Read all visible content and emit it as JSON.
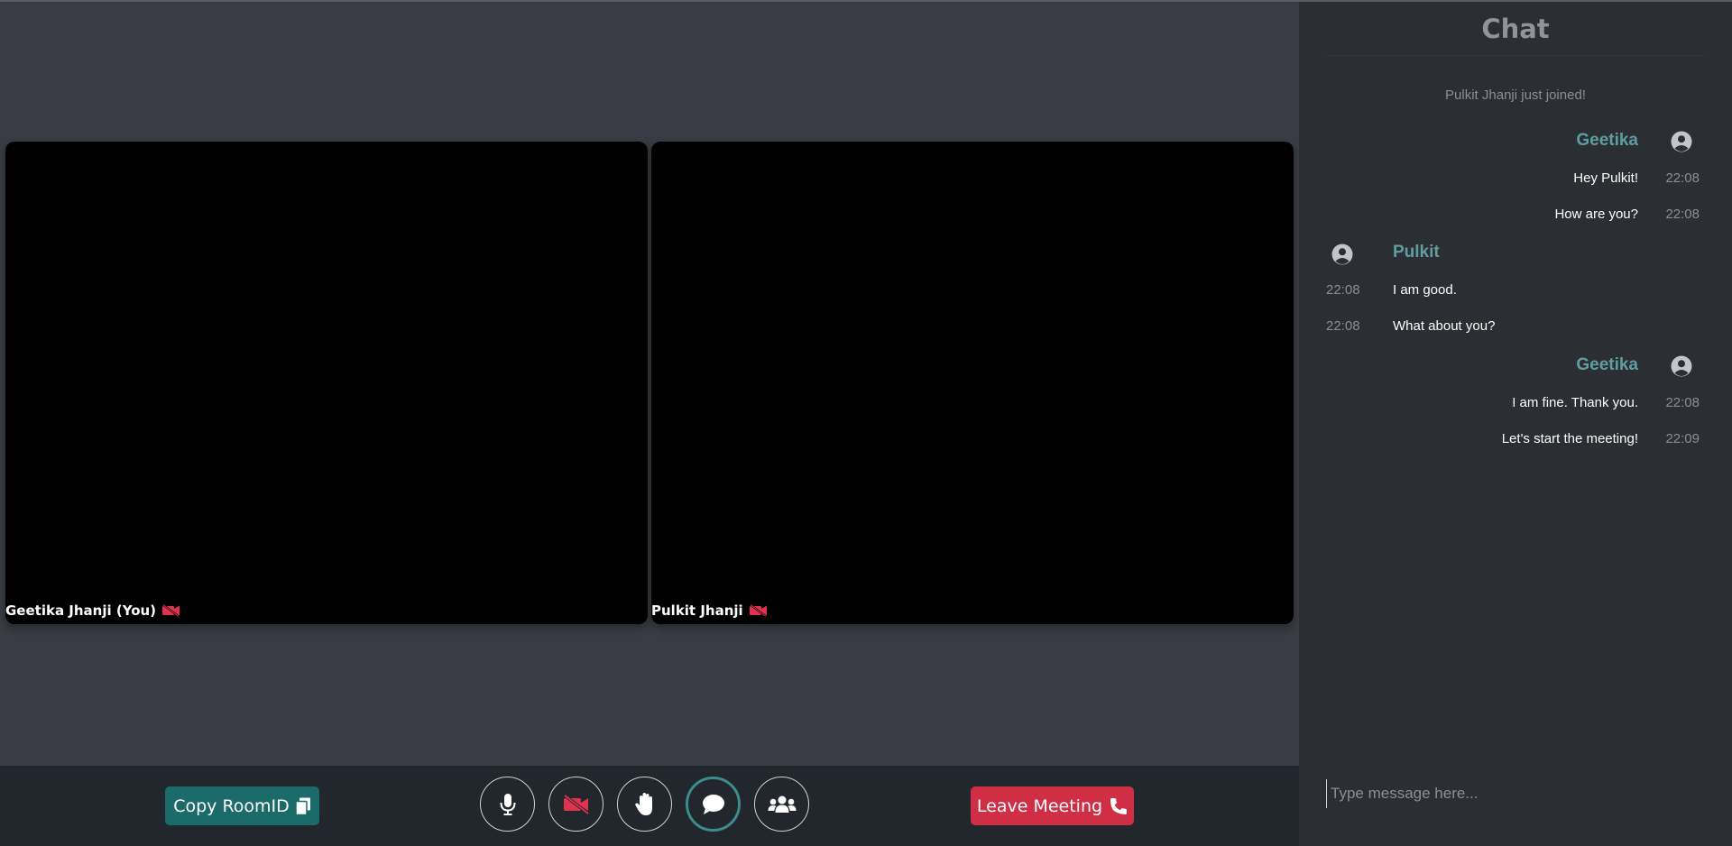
{
  "colors": {
    "stage_bg": "#393c44",
    "bar_bg": "#22262d",
    "chat_bg": "#2b2e33",
    "accent_teal": "#1b6b6a",
    "sender_teal": "#5e9ea0",
    "leave_red": "#cf2e45",
    "cam_off_red": "#e0334f"
  },
  "participants": [
    {
      "name": "Geetika Jhanji (You)",
      "status_icon": "video-off-icon"
    },
    {
      "name": "Pulkit Jhanji",
      "status_icon": "video-off-icon"
    }
  ],
  "toolbar": {
    "copy_room_label": "Copy RoomID",
    "copy_icon": "copy-icon",
    "controls": [
      "microphone-icon",
      "video-off-icon",
      "raise-hand-icon",
      "chat-bubble-icon",
      "participants-icon"
    ],
    "leave_label": "Leave Meeting",
    "leave_icon": "phone-icon"
  },
  "chat": {
    "title": "Chat",
    "system_message": "Pulkit Jhanji just joined!",
    "groups": [
      {
        "sender": "Geetika",
        "side": "right",
        "messages": [
          {
            "text": "Hey Pulkit!",
            "time": "22:08"
          },
          {
            "text": "How are you?",
            "time": "22:08"
          }
        ]
      },
      {
        "sender": "Pulkit",
        "side": "left",
        "messages": [
          {
            "text": "I am good.",
            "time": "22:08"
          },
          {
            "text": "What about you?",
            "time": "22:08"
          }
        ]
      },
      {
        "sender": "Geetika",
        "side": "right",
        "messages": [
          {
            "text": "I am fine. Thank you.",
            "time": "22:08"
          },
          {
            "text": "Let's start the meeting!",
            "time": "22:09"
          }
        ]
      }
    ],
    "input_placeholder": "Type message here..."
  }
}
